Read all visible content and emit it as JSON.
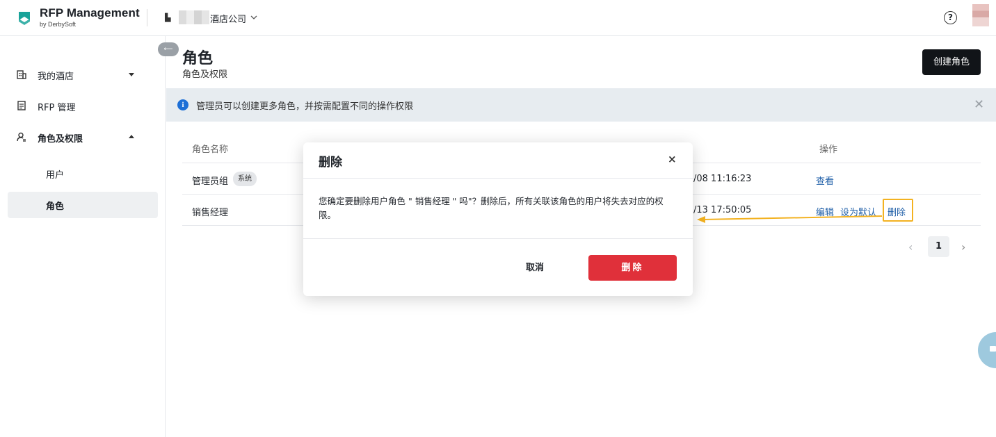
{
  "header": {
    "brand": "RFP Management",
    "brand_sub": "by DerbySoft",
    "company_name": "酒店公司",
    "help_label": "?"
  },
  "sidebar": {
    "items": [
      {
        "label": "我的酒店",
        "icon": "building-icon",
        "expanded": false
      },
      {
        "label": "RFP 管理",
        "icon": "document-icon"
      },
      {
        "label": "角色及权限",
        "icon": "user-settings-icon",
        "expanded": true
      }
    ],
    "sub_items": [
      {
        "label": "用户",
        "active": false
      },
      {
        "label": "角色",
        "active": true
      }
    ]
  },
  "page": {
    "title": "角色",
    "subtitle": "角色及权限",
    "create_button": "创建角色"
  },
  "info_bar": {
    "icon": "info-icon",
    "text": "管理员可以创建更多角色，并按需配置不同的操作权限"
  },
  "table": {
    "columns": [
      "角色名称",
      "操作"
    ],
    "rows": [
      {
        "name": "管理员组",
        "tag": "系统",
        "time": "/08 11:16:23",
        "actions": [
          "查看"
        ]
      },
      {
        "name": "销售经理",
        "tag": "",
        "time": "/13 17:50:05",
        "actions": [
          "编辑",
          "设为默认",
          "删除"
        ]
      }
    ]
  },
  "pagination": {
    "current_page": "1",
    "prev": "‹",
    "next": "›"
  },
  "modal": {
    "title": "删除",
    "close": "×",
    "message": "您确定要删除用户角色 \" 销售经理 \" 吗\"？删除后，所有关联该角色的用户将失去对应的权限。",
    "cancel_label": "取消",
    "confirm_label": "删除"
  },
  "colors": {
    "brand": "#1aa39a",
    "link": "#1f5fa8",
    "danger": "#e0303a",
    "highlight": "#f3b221",
    "dark_button": "#111418"
  }
}
